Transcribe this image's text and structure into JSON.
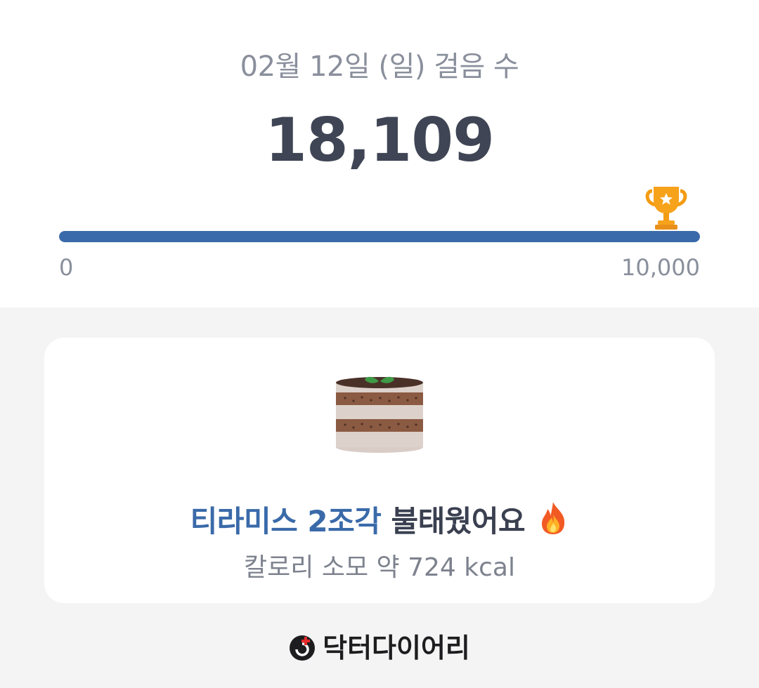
{
  "summary": {
    "date_label": "02월 12일 (일) 걸음 수",
    "steps": "18,109",
    "goal_progress": 1.0,
    "axis_min": "0",
    "axis_max": "10,000",
    "goal_icon": "trophy-icon"
  },
  "card": {
    "food_icon": "tiramisu-cake-icon",
    "food_highlight": "티라미스 2조각",
    "burn_suffix": " 불태웠어요",
    "fire_icon": "fire-icon",
    "calories": "칼로리 소모 약 724 kcal"
  },
  "brand": {
    "name": "닥터다이어리",
    "logo_icon": "doctor-diary-logo-icon"
  },
  "colors": {
    "accent": "#3a6aa9",
    "page_background": "#f4f4f4",
    "card_background": "#ffffff",
    "trophy": "#f7a21b"
  }
}
